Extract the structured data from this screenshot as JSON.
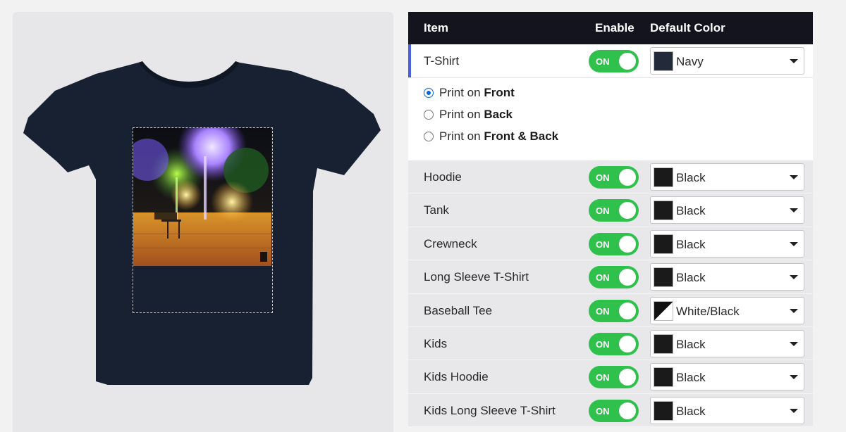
{
  "table": {
    "headers": {
      "item": "Item",
      "enable": "Enable",
      "color": "Default Color"
    },
    "active_row": {
      "name": "T-Shirt",
      "toggle": "ON",
      "color": "Navy",
      "swatch": "#232b3b"
    },
    "print_options": [
      {
        "prefix": "Print on",
        "side": "Front",
        "checked": true
      },
      {
        "prefix": "Print on",
        "side": "Back",
        "checked": false
      },
      {
        "prefix": "Print on",
        "side": "Front & Back",
        "checked": false
      }
    ],
    "rows": [
      {
        "name": "Hoodie",
        "toggle": "ON",
        "color": "Black",
        "swatch": "#1a1a1a"
      },
      {
        "name": "Tank",
        "toggle": "ON",
        "color": "Black",
        "swatch": "#1a1a1a"
      },
      {
        "name": "Crewneck",
        "toggle": "ON",
        "color": "Black",
        "swatch": "#1a1a1a"
      },
      {
        "name": "Long Sleeve T-Shirt",
        "toggle": "ON",
        "color": "Black",
        "swatch": "#1a1a1a"
      },
      {
        "name": "Baseball Tee",
        "toggle": "ON",
        "color": "White/Black",
        "swatch": "split"
      },
      {
        "name": "Kids",
        "toggle": "ON",
        "color": "Black",
        "swatch": "#1a1a1a"
      },
      {
        "name": "Kids Hoodie",
        "toggle": "ON",
        "color": "Black",
        "swatch": "#1a1a1a"
      },
      {
        "name": "Kids Long Sleeve T-Shirt",
        "toggle": "ON",
        "color": "Black",
        "swatch": "#1a1a1a"
      }
    ]
  },
  "colors": {
    "header_bg": "#14141f",
    "toggle_on": "#2fc14c",
    "accent": "#4a5ee0",
    "shirt": "#172131",
    "radio": "#0a66d8"
  }
}
